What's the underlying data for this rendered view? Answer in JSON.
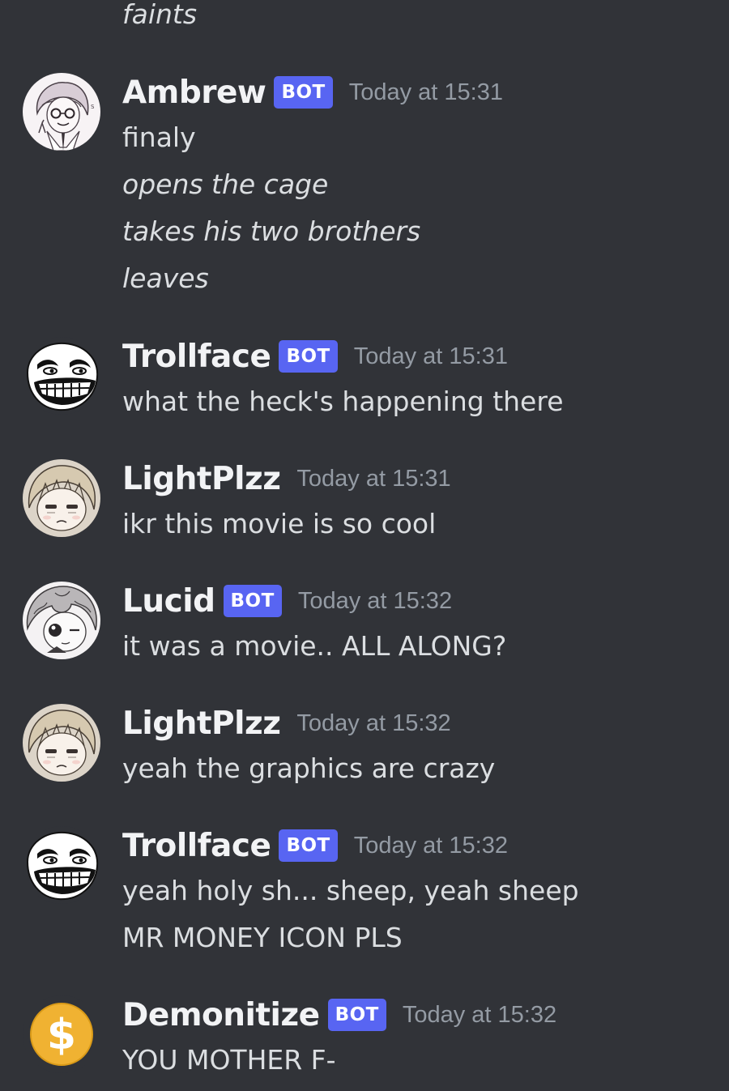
{
  "messages": [
    {
      "lines": [
        {
          "text": "faints",
          "italic": true
        }
      ]
    },
    {
      "author": "Ambrew",
      "bot": true,
      "bot_label": "BOT",
      "timestamp": "Today at 15:31",
      "avatar_icon": "sketch-avatar-icon",
      "lines": [
        {
          "text": "finaly",
          "italic": false
        },
        {
          "text": "opens the cage",
          "italic": true
        },
        {
          "text": "takes his two brothers",
          "italic": true
        },
        {
          "text": "leaves",
          "italic": true
        }
      ]
    },
    {
      "author": "Trollface",
      "bot": true,
      "bot_label": "BOT",
      "timestamp": "Today at 15:31",
      "avatar_icon": "trollface-icon",
      "lines": [
        {
          "text": "what the heck's happening there",
          "italic": false
        }
      ]
    },
    {
      "author": "LightPlzz",
      "bot": false,
      "timestamp": "Today at 15:31",
      "avatar_icon": "anime-boy-avatar-icon",
      "lines": [
        {
          "text": "ikr this movie is so cool",
          "italic": false
        }
      ]
    },
    {
      "author": "Lucid",
      "bot": true,
      "bot_label": "BOT",
      "timestamp": "Today at 15:32",
      "avatar_icon": "grey-hair-avatar-icon",
      "lines": [
        {
          "text": "it was a movie.. ALL ALONG?",
          "italic": false
        }
      ]
    },
    {
      "author": "LightPlzz",
      "bot": false,
      "timestamp": "Today at 15:32",
      "avatar_icon": "anime-boy-avatar-icon",
      "lines": [
        {
          "text": "yeah the graphics are crazy",
          "italic": false
        }
      ]
    },
    {
      "author": "Trollface",
      "bot": true,
      "bot_label": "BOT",
      "timestamp": "Today at 15:32",
      "avatar_icon": "trollface-icon",
      "lines": [
        {
          "text": "yeah holy sh... sheep, yeah sheep",
          "italic": false
        },
        {
          "text": "MR MONEY ICON PLS",
          "italic": false
        }
      ]
    },
    {
      "author": "Demonitize",
      "bot": true,
      "bot_label": "BOT",
      "timestamp": "Today at 15:32",
      "avatar_icon": "dollar-coin-icon",
      "avatar_text": "$",
      "lines": [
        {
          "text": "YOU MOTHER F-",
          "italic": false
        }
      ]
    }
  ],
  "colors": {
    "background": "#313338",
    "bot_tag": "#5865f2",
    "timestamp": "#949ba4",
    "username": "#f2f3f5",
    "message_text": "#dbdee1",
    "coin_gold": "#f0b232"
  }
}
